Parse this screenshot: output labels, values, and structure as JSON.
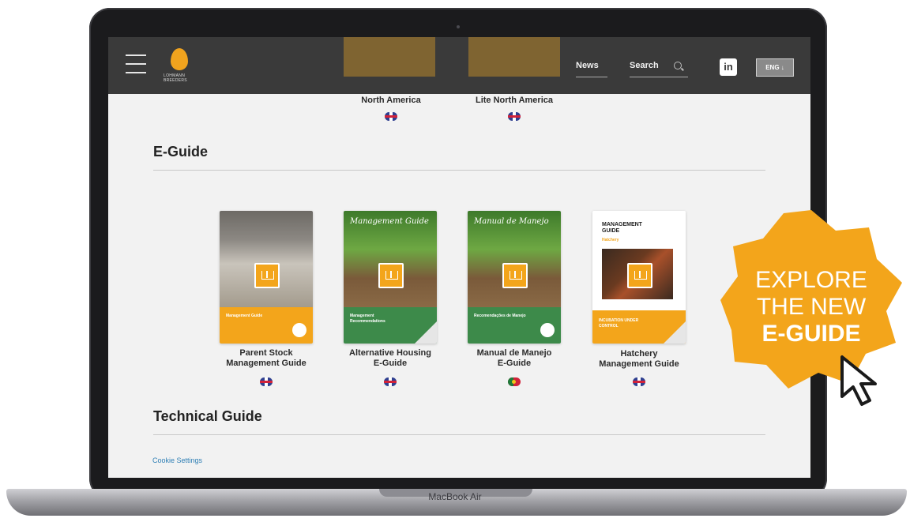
{
  "header": {
    "logo_text_line1": "LOHMANN",
    "logo_text_line2": "BREEDERS",
    "nav": [
      {
        "label": "News"
      },
      {
        "label": "Search"
      }
    ],
    "social": "in",
    "language": "ENG ↓"
  },
  "top_row": [
    {
      "label": "North America",
      "flag": "uk-flag"
    },
    {
      "label": "Lite North America",
      "flag": "uk-flag"
    }
  ],
  "eguide_section": {
    "title": "E-Guide",
    "items": [
      {
        "label_line1": "Parent Stock",
        "label_line2": "Management Guide",
        "cover_band_text": "Management Guide",
        "flag": "uk-flag"
      },
      {
        "label_line1": "Alternative Housing",
        "label_line2": "E-Guide",
        "cover_title": "Management Guide",
        "cover_band_text": "Management Recommendations",
        "flag": "uk-flag"
      },
      {
        "label_line1": "Manual de Manejo",
        "label_line2": "E-Guide",
        "cover_title": "Manual de Manejo",
        "cover_band_text": "Recomendações de Manejo",
        "flag": "portugal-flag"
      },
      {
        "label_line1": "Hatchery",
        "label_line2": "Management Guide",
        "cover_heading_line1": "MANAGEMENT",
        "cover_heading_line2": "GUIDE",
        "cover_sub": "Hatchery",
        "cover_band_text": "INCUBATION UNDER CONTROL",
        "flag": "uk-flag"
      }
    ]
  },
  "technical_section": {
    "title": "Technical Guide"
  },
  "cookie_settings": "Cookie Settings",
  "badge": {
    "line1": "EXPLORE",
    "line2": "THE NEW",
    "line3": "E-GUIDE",
    "color": "#f3a51b"
  },
  "laptop_label": "MacBook Air",
  "colors": {
    "accent": "#f3a51b",
    "header_bg": "#3a3a3a",
    "link": "#2f7fb5"
  }
}
